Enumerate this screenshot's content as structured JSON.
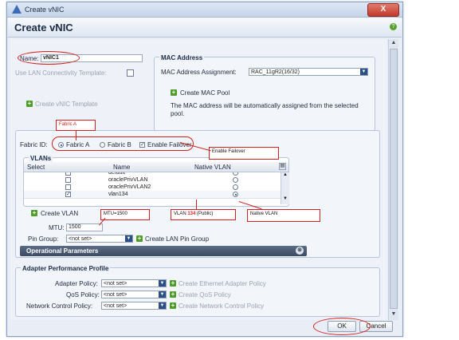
{
  "window": {
    "title": "Create vNIC",
    "close_label": "X"
  },
  "header": {
    "heading": "Create vNIC",
    "help_icon": "?"
  },
  "form": {
    "name_label": "Name:",
    "name_value": "vNIC1",
    "use_template_label": "Use LAN Connectivity Template:",
    "create_template_label": "Create vNIC Template"
  },
  "mac": {
    "title": "MAC Address",
    "assignment_label": "MAC Address Assignment:",
    "assignment_value": "RAC_11gR2(16/32)",
    "create_pool_label": "Create MAC Pool",
    "info": "The MAC address will be automatically assigned from the selected pool."
  },
  "fabric": {
    "label": "Fabric ID:",
    "option_a": "Fabric A",
    "option_b": "Fabric B",
    "failover_label": "Enable Failover"
  },
  "vlans": {
    "title": "VLANs",
    "headers": [
      "Select",
      "Name",
      "Native VLAN"
    ],
    "rows": [
      {
        "name": "default",
        "selected": false,
        "native": false
      },
      {
        "name": "oraclePrivVLAN",
        "selected": false,
        "native": false
      },
      {
        "name": "oraclePrivVLAN2",
        "selected": false,
        "native": false
      },
      {
        "name": "vlan134",
        "selected": true,
        "native": true
      }
    ],
    "create_label": "Create VLAN"
  },
  "mtu": {
    "label": "MTU:",
    "value": "1500"
  },
  "pin_group": {
    "label": "Pin Group:",
    "value": "<not set>",
    "create_label": "Create LAN Pin Group"
  },
  "operational": {
    "label": "Operational Parameters"
  },
  "adapter": {
    "title": "Adapter Performance Profile",
    "rows": [
      {
        "label": "Adapter Policy:",
        "value": "<not set>",
        "create_label": "Create Ethernet Adapter Policy"
      },
      {
        "label": "QoS Policy:",
        "value": "<not set>",
        "create_label": "Create QoS Policy"
      },
      {
        "label": "Network Control Policy:",
        "value": "<not set>",
        "create_label": "Create Network Control Policy"
      }
    ]
  },
  "annotations": {
    "fabric_a": "Fabric A",
    "enable_failover": "Enable Failover",
    "mtu": "MTU=1500",
    "vlan_prefix": "VLAN ",
    "vlan_number": "134",
    "vlan_suffix": " (Public)",
    "native_vlan": "Native VLAN"
  },
  "footer": {
    "ok_label": "OK",
    "cancel_label": "Cancel"
  },
  "colors": {
    "accent": "#2c4f86",
    "annotation": "#d21f1f",
    "add_icon": "#4f9c2a"
  }
}
